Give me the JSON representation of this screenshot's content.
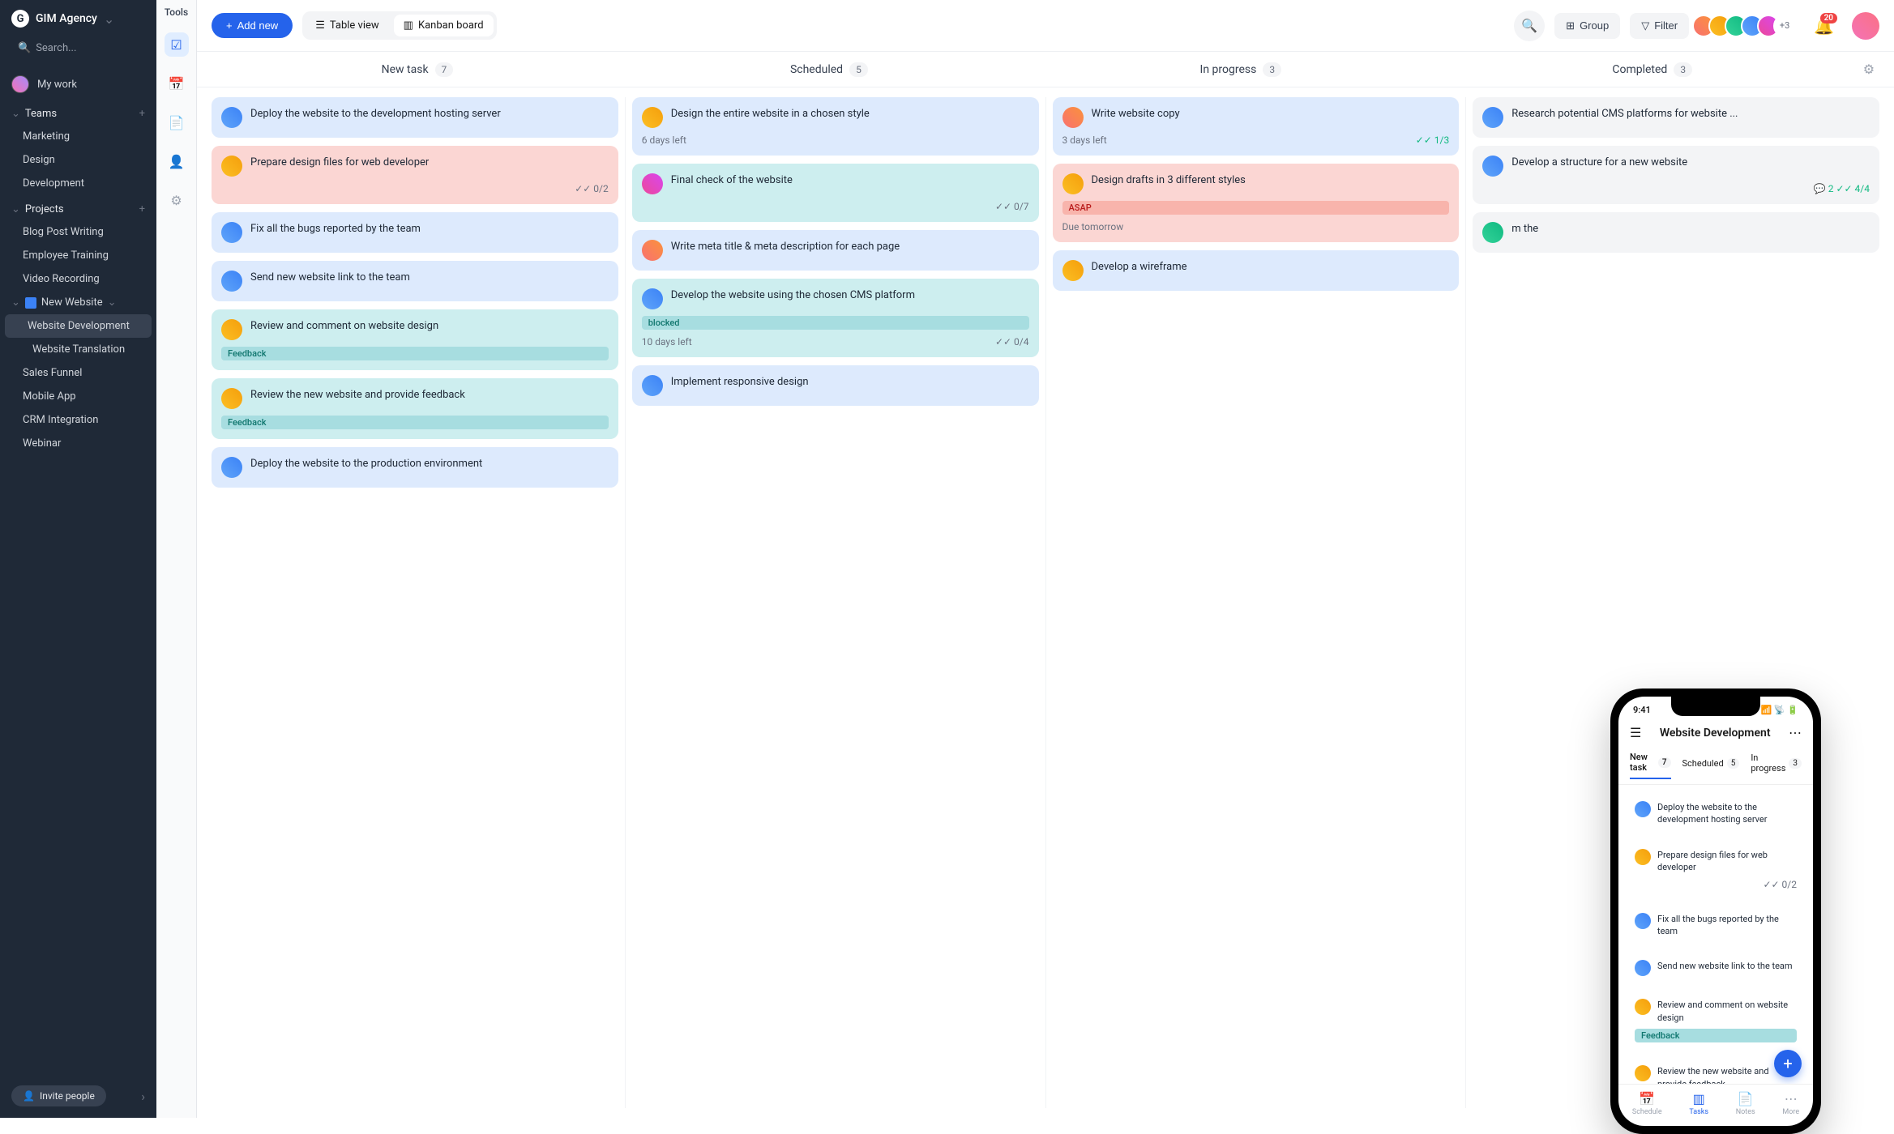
{
  "workspace": {
    "name": "GIM Agency"
  },
  "search": {
    "placeholder": "Search..."
  },
  "mywork": {
    "label": "My work"
  },
  "sections": {
    "teams": "Teams",
    "projects": "Projects"
  },
  "teams": [
    "Marketing",
    "Design",
    "Development"
  ],
  "projects": {
    "top": [
      "Blog Post Writing",
      "Employee Training",
      "Video Recording"
    ],
    "newWebsite": {
      "label": "New Website",
      "children": [
        "Website Development",
        "Website Translation"
      ],
      "activeIndex": 0
    },
    "rest": [
      "Sales Funnel",
      "Mobile App",
      "CRM Integration",
      "Webinar"
    ]
  },
  "invite": {
    "label": "Invite people"
  },
  "toolsRail": {
    "label": "Tools"
  },
  "topbar": {
    "addNew": "Add new",
    "tableView": "Table view",
    "kanban": "Kanban board",
    "group": "Group",
    "filter": "Filter",
    "avatarsExtra": "+3",
    "notifications": "20"
  },
  "columns": [
    {
      "name": "New task",
      "count": "7"
    },
    {
      "name": "Scheduled",
      "count": "5"
    },
    {
      "name": "In progress",
      "count": "3"
    },
    {
      "name": "Completed",
      "count": "3"
    }
  ],
  "cards": {
    "newtask": [
      {
        "title": "Deploy the website to the development hosting server",
        "color": "blue",
        "av": "av4"
      },
      {
        "title": "Prepare design files for web developer",
        "color": "red",
        "av": "av2",
        "checks": "0/2"
      },
      {
        "title": "Fix all the bugs reported by the team",
        "color": "blue",
        "av": "av4"
      },
      {
        "title": "Send new website link to the team",
        "color": "blue",
        "av": "av4"
      },
      {
        "title": "Review and comment on website design",
        "color": "teal",
        "av": "av2",
        "tag": "Feedback",
        "tagClass": "feedback"
      },
      {
        "title": "Review the new website and provide feedback",
        "color": "teal",
        "av": "av2",
        "tag": "Feedback",
        "tagClass": "feedback"
      },
      {
        "title": "Deploy the website to the production environment",
        "color": "blue",
        "av": "av4"
      }
    ],
    "scheduled": [
      {
        "title": "Design the entire website in a chosen style",
        "color": "blue",
        "av": "av2",
        "meta": "6 days left"
      },
      {
        "title": "Final check of the website",
        "color": "teal",
        "av": "av5",
        "checks": "0/7"
      },
      {
        "title": "Write meta title & meta description for each page",
        "color": "blue",
        "av": "av1"
      },
      {
        "title": "Develop the website using the chosen CMS platform",
        "color": "teal",
        "av": "av4",
        "tag": "blocked",
        "tagClass": "blocked",
        "meta": "10 days left",
        "checks": "0/4"
      },
      {
        "title": "Implement responsive design",
        "color": "blue",
        "av": "av4"
      }
    ],
    "inprogress": [
      {
        "title": "Write website copy",
        "color": "blue",
        "av": "av1",
        "meta": "3 days left",
        "checks": "1/3",
        "checksDone": true
      },
      {
        "title": "Design drafts in 3 different styles",
        "color": "red",
        "av": "av2",
        "tag": "ASAP",
        "tagClass": "asap",
        "meta": "Due tomorrow"
      },
      {
        "title": "Develop a wireframe",
        "color": "blue",
        "av": "av2"
      }
    ],
    "completed": [
      {
        "title": "Research potential CMS platforms for website ...",
        "av": "av4"
      },
      {
        "title": "Develop a structure for a new website",
        "av": "av4",
        "comments": "2",
        "checks": "4/4",
        "checksDone": true
      },
      {
        "title": "",
        "partial": "m the",
        "av": "av3"
      }
    ]
  },
  "phone": {
    "time": "9:41",
    "title": "Website Development",
    "tabs": [
      {
        "label": "New task",
        "count": "7"
      },
      {
        "label": "Scheduled",
        "count": "5"
      },
      {
        "label": "In progress",
        "count": "3"
      }
    ],
    "cards": [
      {
        "title": "Deploy the website to the development hosting server",
        "color": "blue",
        "av": "av4"
      },
      {
        "title": "Prepare design files for web developer",
        "color": "red",
        "av": "av2",
        "checks": "0/2"
      },
      {
        "title": "Fix all the bugs reported by the team",
        "color": "blue",
        "av": "av4"
      },
      {
        "title": "Send new website link to the team",
        "color": "blue",
        "av": "av4"
      },
      {
        "title": "Review and comment on website design",
        "color": "teal",
        "av": "av2",
        "tag": "Feedback",
        "tagClass": "feedback"
      },
      {
        "title": "Review the new website and provide feedback",
        "color": "teal",
        "av": "av2"
      }
    ],
    "nav": [
      "Schedule",
      "Tasks",
      "Notes",
      "More"
    ]
  }
}
